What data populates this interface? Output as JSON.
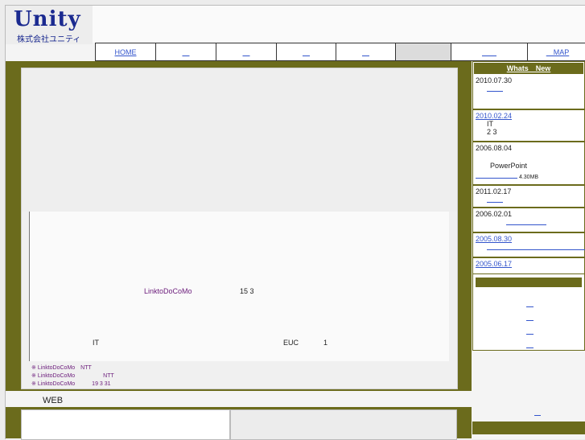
{
  "logo": {
    "word": "Unity",
    "sub": "株式会社ユニティ"
  },
  "nav": {
    "items": [
      {
        "label": "HOME",
        "width": 74,
        "grey": false
      },
      {
        "label": "　",
        "width": 74,
        "grey": false
      },
      {
        "label": "　",
        "width": 74,
        "grey": false
      },
      {
        "label": "　",
        "width": 73,
        "grey": false
      },
      {
        "label": "　",
        "width": 73,
        "grey": false
      },
      {
        "label": "",
        "width": 68,
        "grey": true
      },
      {
        "label": "　　",
        "width": 94,
        "grey": false
      },
      {
        "label": "　MAP",
        "width": 74,
        "grey": false
      }
    ]
  },
  "main": {
    "line1_link": "LinktoDoCoMo",
    "line1_num": "15 3",
    "line2_a": "IT",
    "line2_b": "EUC",
    "line2_c": "1",
    "notes": [
      {
        "star": "※",
        "text": "LinktoDoCoMo　NTT"
      },
      {
        "star": "※",
        "text": "LinktoDoCoMo　　　　　NTT"
      },
      {
        "star": "※",
        "text": "LinktoDoCoMo　　　19 3 31"
      }
    ]
  },
  "web_label": "WEB",
  "sidebar": {
    "news_title": "Whats　New",
    "news": [
      {
        "date": "2010.07.30",
        "link": false,
        "lines": []
      },
      {
        "date": "2010.02.24",
        "link": true,
        "lines": [
          "IT",
          "2  3"
        ]
      },
      {
        "date": "2006.08.04",
        "link": false,
        "lines": [
          "PowerPoint"
        ],
        "size": "4.30MB"
      },
      {
        "date": "2011.02.17",
        "link": false,
        "lines": []
      },
      {
        "date": "2006.02.01",
        "link": false,
        "lines": []
      },
      {
        "date": "2005.08.30",
        "link": true,
        "lines": []
      },
      {
        "date": "2005.06.17",
        "link": true,
        "lines": []
      }
    ]
  }
}
